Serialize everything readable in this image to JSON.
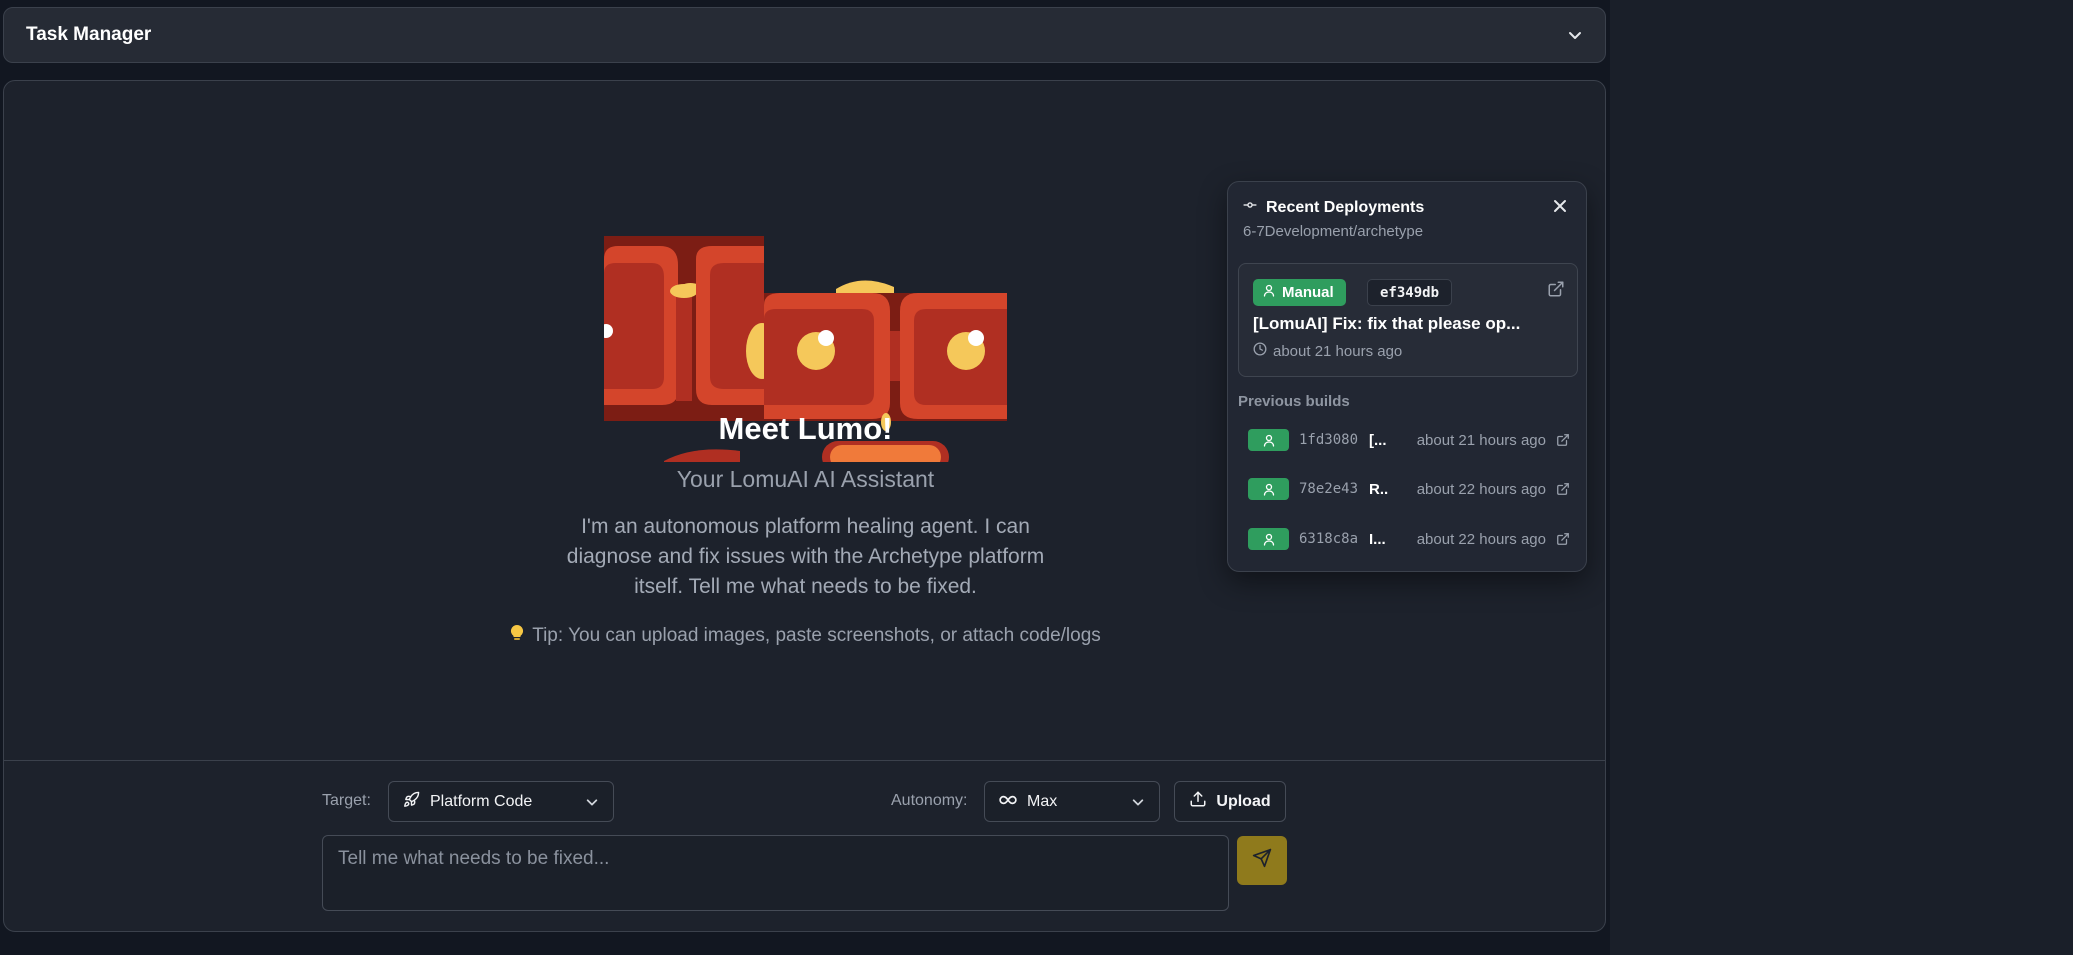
{
  "task_manager": {
    "title": "Task Manager"
  },
  "hero": {
    "title": "Meet Lumo!",
    "subtitle": "Your LomuAI AI Assistant",
    "description": "I'm an autonomous platform healing agent. I can diagnose and fix issues with the Archetype platform itself. Tell me what needs to be fixed.",
    "tip": "Tip: You can upload images, paste screenshots, or attach code/logs"
  },
  "controls": {
    "target_label": "Target:",
    "target_value": "Platform Code",
    "autonomy_label": "Autonomy:",
    "autonomy_value": "Max",
    "upload_label": "Upload",
    "input_placeholder": "Tell me what needs to be fixed..."
  },
  "deployments": {
    "title": "Recent Deployments",
    "repo": "6-7Development/archetype",
    "latest": {
      "trigger": "Manual",
      "hash": "ef349db",
      "message": "[LomuAI] Fix: fix that please op...",
      "time": "about 21 hours ago"
    },
    "previous_label": "Previous builds",
    "previous": [
      {
        "hash": "1fd3080",
        "message": "[...",
        "time": "about 21 hours ago"
      },
      {
        "hash": "78e2e43",
        "message": "R..",
        "time": "about 22 hours ago"
      },
      {
        "hash": "6318c8a",
        "message": "I...",
        "time": "about 22 hours ago"
      }
    ]
  },
  "colors": {
    "background": "#121721",
    "panel": "#1d222c",
    "success_badge": "#2f9d5e",
    "send_button": "#8f7a1c",
    "mascot_primary": "#b02f22",
    "mascot_accent": "#f5c85a"
  },
  "icons": {
    "task_toggle": "chevron-down-icon",
    "deployments": "git-commit-icon",
    "close": "close-icon",
    "external": "external-link-icon",
    "user": "user-icon",
    "clock": "clock-icon",
    "tip": "lightbulb-icon",
    "target": "rocket-icon",
    "autonomy": "infinity-icon",
    "upload": "upload-icon",
    "send": "send-icon"
  }
}
